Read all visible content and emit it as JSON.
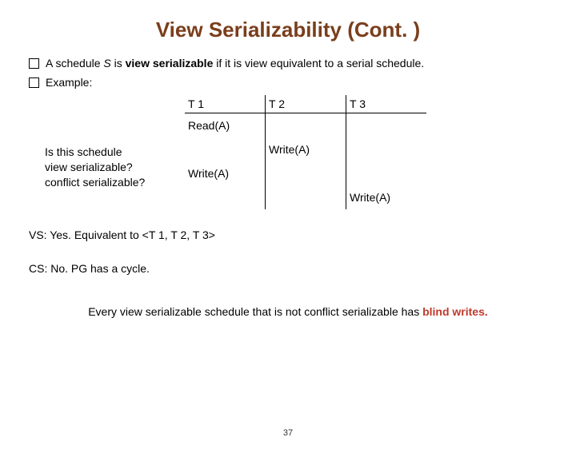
{
  "title": "View Serializability (Cont. )",
  "bullets": {
    "b1_pre": "A schedule ",
    "b1_var": "S",
    "b1_mid": " is ",
    "b1_bold": "view serializable ",
    "b1_post": " if it is view equivalent to a serial schedule.",
    "b2": "Example:"
  },
  "question": {
    "l1": "Is this schedule",
    "l2": "view serializable?",
    "l3": "conflict serializable?"
  },
  "schedule": {
    "h1": "T 1",
    "h2": "T 2",
    "h3": "T 3",
    "r1c1": "Read(A)",
    "r2c2": "Write(A)",
    "r3c1": "Write(A)",
    "r4c3": "Write(A)"
  },
  "answers": {
    "vs": "VS: Yes. Equivalent to <T 1, T 2, T 3>",
    "cs": "CS: No. PG has a cycle."
  },
  "footnote": {
    "pre": "Every view serializable schedule that is not conflict serializable has ",
    "blind": "blind writes.",
    "post": ""
  },
  "pagenum": "37"
}
